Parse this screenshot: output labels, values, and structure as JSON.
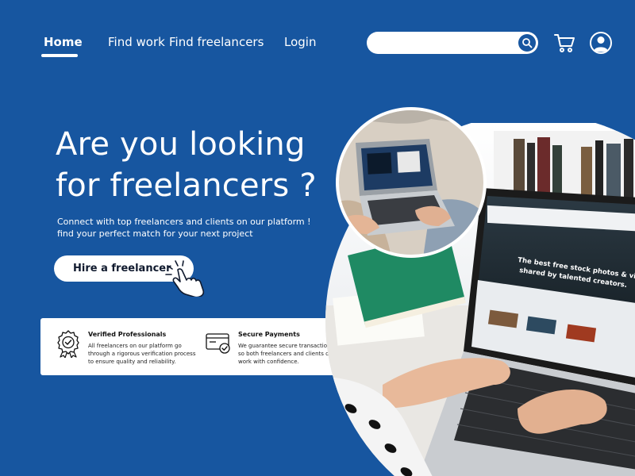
{
  "nav": {
    "home": "Home",
    "find_work": "Find work",
    "find_freelancers": "Find freelancers",
    "login": "Login"
  },
  "search": {
    "placeholder": "",
    "value": ""
  },
  "hero": {
    "title_line1": "Are you looking",
    "title_line2": "for freelancers ?",
    "sub_line1": "Connect with top freelancers and clients on our platform !",
    "sub_line2": "find your perfect match for your next project",
    "cta_label": "Hire a freelancer"
  },
  "features": [
    {
      "title": "Verified Professionals",
      "desc_line1": "All freelancers on our platform go",
      "desc_line2": "through a rigorous verification process",
      "desc_line3": "to ensure quality and reliability."
    },
    {
      "title": "Secure Payments",
      "desc_line1": "We guarantee secure transactions,",
      "desc_line2": "so both freelancers and clients can",
      "desc_line3": "work with confidence."
    }
  ],
  "screen": {
    "headline1": "The best free stock photos & videos",
    "headline2": "shared by talented creators."
  },
  "colors": {
    "background": "#1756a0",
    "accent": "#ffffff"
  },
  "icons": [
    "search-icon",
    "cart-icon",
    "user-profile-icon",
    "pointing-hand-icon",
    "verified-badge-icon",
    "secure-card-icon"
  ]
}
